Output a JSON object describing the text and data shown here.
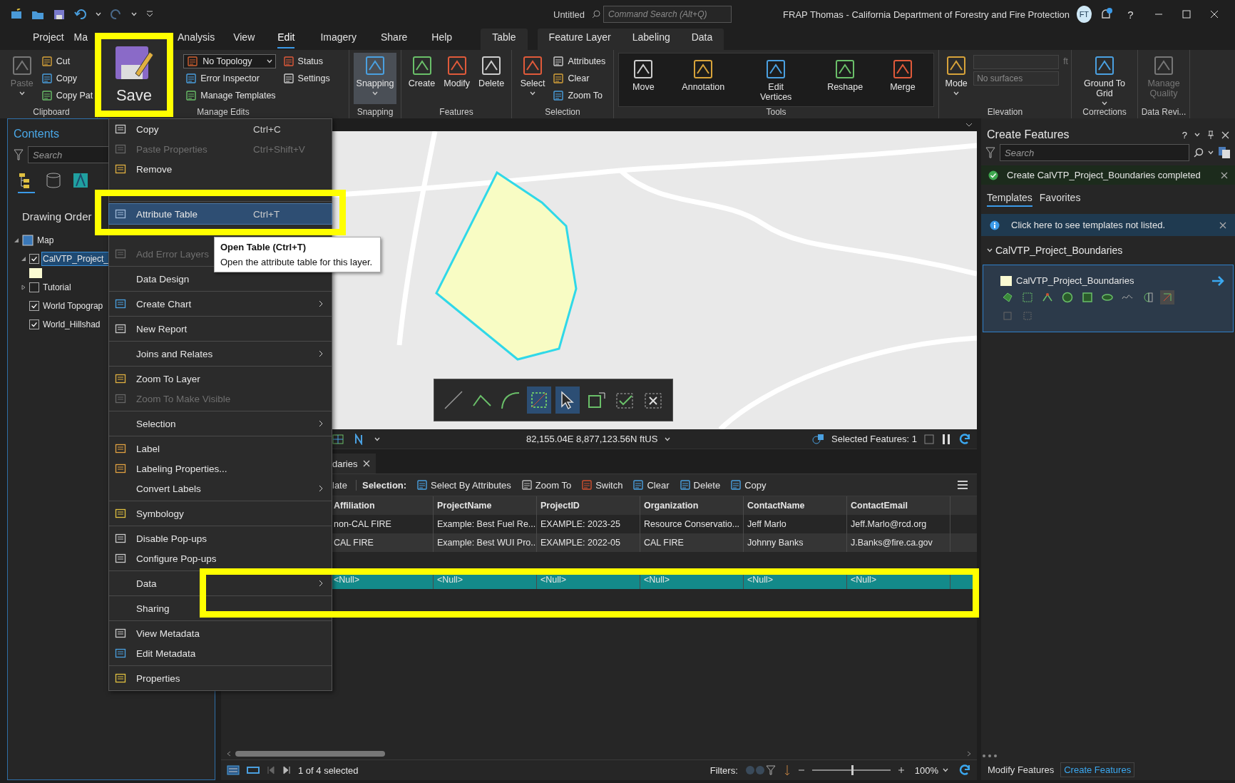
{
  "title_bar": {
    "document": "Untitled",
    "command_search": {
      "placeholder": "Command Search (Alt+Q)"
    },
    "title": "FRAP Thomas - California Department of Forestry and Fire Protection",
    "avatar": "FT",
    "help": "?"
  },
  "ribbon_tabs": [
    {
      "label": "Project",
      "selected": false
    },
    {
      "label": "Ma",
      "selected": false
    },
    {
      "label": "Analysis",
      "selected": false
    },
    {
      "label": "View",
      "selected": false
    },
    {
      "label": "Edit",
      "selected": true
    },
    {
      "label": "Imagery",
      "selected": false
    },
    {
      "label": "Share",
      "selected": false
    },
    {
      "label": "Help",
      "selected": false
    }
  ],
  "table_tabs": [
    {
      "label": "Table",
      "selected": false
    }
  ],
  "feature_layer_tabs": [
    {
      "label": "Feature Layer",
      "selected": false
    },
    {
      "label": "Labeling",
      "selected": false
    },
    {
      "label": "Data",
      "selected": false
    }
  ],
  "ribbon_groups": [
    {
      "label": "Clipboard",
      "kind": "plain",
      "buttons": [
        {
          "kind": "large",
          "label": "Paste",
          "disabled": true,
          "dropdown": true
        },
        {
          "kind": "small",
          "label": "Cut",
          "disabled": false
        },
        {
          "kind": "small",
          "label": "Copy",
          "disabled": false
        },
        {
          "kind": "small",
          "label": "Copy Pat",
          "disabled": false
        }
      ]
    },
    {
      "label": "Manage Edits",
      "kind": "plain",
      "buttons": [
        {
          "kind": "dropdown",
          "label": "No Topology",
          "disabled": false
        },
        {
          "kind": "small",
          "label": "Error Inspector",
          "disabled": false
        },
        {
          "kind": "small",
          "label": "Manage Templates",
          "disabled": false
        },
        {
          "kind": "small",
          "label": "Status",
          "disabled": false
        },
        {
          "kind": "small",
          "label": "Settings",
          "disabled": false
        }
      ]
    },
    {
      "label": "Snapping",
      "kind": "plain",
      "buttons": [
        {
          "kind": "large",
          "label": "Snapping",
          "disabled": false,
          "dropdown": true,
          "on": true
        }
      ]
    },
    {
      "label": "Features",
      "kind": "plain",
      "buttons": [
        {
          "kind": "large",
          "label": "Create",
          "disabled": false
        },
        {
          "kind": "large",
          "label": "Modify",
          "disabled": false
        },
        {
          "kind": "large",
          "label": "Delete",
          "disabled": false
        }
      ]
    },
    {
      "label": "Selection",
      "kind": "plain",
      "buttons": [
        {
          "kind": "large",
          "label": "Select",
          "disabled": false,
          "dropdown": true
        },
        {
          "kind": "small",
          "label": "Attributes",
          "disabled": false
        },
        {
          "kind": "small",
          "label": "Clear",
          "disabled": false
        },
        {
          "kind": "small",
          "label": "Zoom To",
          "disabled": false
        }
      ]
    },
    {
      "label": "Tools",
      "kind": "gallery",
      "buttons": [
        {
          "kind": "large",
          "label": "Move",
          "disabled": false
        },
        {
          "kind": "large",
          "label": "Annotation",
          "disabled": false
        },
        {
          "kind": "large",
          "label": "Edit Vertices",
          "disabled": false
        },
        {
          "kind": "large",
          "label": "Reshape",
          "disabled": false
        },
        {
          "kind": "large",
          "label": "Merge",
          "disabled": false
        }
      ]
    },
    {
      "label": "Elevation",
      "kind": "plain",
      "buttons": [
        {
          "kind": "large",
          "label": "Mode",
          "disabled": false,
          "dropdown": true
        },
        {
          "kind": "unit-field",
          "unit": "ft",
          "disabled": true
        },
        {
          "kind": "field",
          "placeholder": "No surfaces",
          "disabled": true
        }
      ]
    },
    {
      "label": "Corrections",
      "kind": "plain",
      "buttons": [
        {
          "kind": "large",
          "label": "Ground To Grid",
          "disabled": false,
          "dropdown": true
        }
      ]
    },
    {
      "label": "Data Revi...",
      "kind": "plain",
      "buttons": [
        {
          "kind": "large",
          "label": "Manage Quality",
          "disabled": true
        }
      ]
    }
  ],
  "save_callout": {
    "label": "Save"
  },
  "contents": {
    "title": "Contents",
    "search": {
      "placeholder": "Search"
    },
    "views": [
      {
        "selected": true
      },
      {
        "selected": false
      },
      {
        "selected": false
      }
    ],
    "heading": "Drawing Order",
    "tree": [
      {
        "label": "Map",
        "expanded": true,
        "children": [
          {
            "label": "CalVTP_Project_",
            "checked": true,
            "selected": true,
            "expanded": true
          },
          {
            "label": "Tutorial",
            "checked": false,
            "selected": false,
            "expanded": false
          },
          {
            "label": "World Topograp",
            "checked": true,
            "selected": false
          },
          {
            "label": "World_Hillshad",
            "checked": true,
            "selected": false
          }
        ]
      }
    ]
  },
  "context_menu": {
    "groups": [
      [
        {
          "kind": "item",
          "label": "Copy",
          "shortcut": "Ctrl+C",
          "disabled": false
        },
        {
          "kind": "item",
          "label": "Paste Properties",
          "shortcut": "Ctrl+Shift+V",
          "disabled": true
        },
        {
          "kind": "item",
          "label": "Remove",
          "disabled": false
        },
        {
          "kind": "covered"
        }
      ],
      [
        {
          "kind": "item",
          "label": "Attribute Table",
          "shortcut": "Ctrl+T",
          "disabled": false,
          "highlighted": true
        },
        {
          "kind": "covered"
        },
        {
          "kind": "item",
          "label": "Add Error Layers",
          "disabled": true
        }
      ],
      [
        {
          "kind": "item",
          "label": "Data Design",
          "disabled": false
        }
      ],
      [
        {
          "kind": "item",
          "label": "Create Chart",
          "disabled": false,
          "submenu": true
        }
      ],
      [
        {
          "kind": "item",
          "label": "New Report",
          "disabled": false
        }
      ],
      [
        {
          "kind": "item",
          "label": "Joins and Relates",
          "disabled": false,
          "submenu": true
        }
      ],
      [
        {
          "kind": "item",
          "label": "Zoom To Layer",
          "disabled": false
        },
        {
          "kind": "item",
          "label": "Zoom To Make Visible",
          "disabled": true
        }
      ],
      [
        {
          "kind": "item",
          "label": "Selection",
          "disabled": false,
          "submenu": true
        }
      ],
      [
        {
          "kind": "item",
          "label": "Label",
          "disabled": false
        },
        {
          "kind": "item",
          "label": "Labeling Properties...",
          "disabled": false
        },
        {
          "kind": "item",
          "label": "Convert Labels",
          "disabled": false,
          "submenu": true
        }
      ],
      [
        {
          "kind": "item",
          "label": "Symbology",
          "disabled": false
        }
      ],
      [
        {
          "kind": "item",
          "label": "Disable Pop-ups",
          "disabled": false
        },
        {
          "kind": "item",
          "label": "Configure Pop-ups",
          "disabled": false
        }
      ],
      [
        {
          "kind": "item",
          "label": "Data",
          "disabled": false,
          "submenu": true
        }
      ],
      [
        {
          "kind": "item",
          "label": "Sharing",
          "disabled": false
        }
      ],
      [
        {
          "kind": "item",
          "label": "View Metadata",
          "disabled": false
        },
        {
          "kind": "item",
          "label": "Edit Metadata",
          "disabled": false
        }
      ],
      [
        {
          "kind": "item",
          "label": "Properties",
          "disabled": false
        }
      ]
    ]
  },
  "tooltip": {
    "title": "Open Table (Ctrl+T)",
    "text": "Open the attribute table for this layer."
  },
  "edit_toolbar": {
    "tools": [
      {
        "selected": false
      },
      {
        "selected": false
      },
      {
        "selected": false
      },
      {
        "selected": true
      },
      {
        "selected": true
      },
      {
        "selected": false
      },
      {
        "selected": false
      },
      {
        "selected": false
      }
    ]
  },
  "map_status": {
    "coordinates": "82,155.04E 8,877,123.56N ftUS",
    "selected_features": "Selected Features: 1"
  },
  "table": {
    "tab": "daries",
    "toolbar": [
      {
        "kind": "text",
        "label": "late"
      },
      {
        "kind": "heading",
        "label": "Selection:"
      },
      {
        "kind": "button",
        "label": "Select By Attributes"
      },
      {
        "kind": "button",
        "label": "Zoom To"
      },
      {
        "kind": "button",
        "label": "Switch"
      },
      {
        "kind": "button",
        "label": "Clear"
      },
      {
        "kind": "button",
        "label": "Delete"
      },
      {
        "kind": "button",
        "label": "Copy"
      }
    ],
    "columns": [
      "Affiliation",
      "ProjectName",
      "ProjectID",
      "Organization",
      "ContactName",
      "ContactEmail"
    ],
    "rows": [
      {
        "selected": false,
        "cells": [
          "non-CAL FIRE",
          "Example: Best Fuel Re...",
          "EXAMPLE: 2023-25",
          "Resource Conservatio...",
          "Jeff Marlo",
          "Jeff.Marlo@rcd.org"
        ]
      },
      {
        "selected": false,
        "cells": [
          "CAL FIRE",
          "Example: Best WUI Pro...",
          "EXAMPLE: 2022-05",
          "CAL FIRE",
          "Johnny Banks",
          "J.Banks@fire.ca.gov"
        ]
      },
      {
        "selected": false,
        "cells": []
      },
      {
        "selected": true,
        "cells": [
          "<Null>",
          "<Null>",
          "<Null>",
          "<Null>",
          "<Null>",
          "<Null>"
        ]
      }
    ],
    "status": {
      "selection": "1 of 4 selected",
      "filters": "Filters:",
      "zoom": {
        "level": 0.5
      },
      "percent": "100%"
    }
  },
  "create_features": {
    "title": "Create Features",
    "help": "?",
    "search": {
      "placeholder": "Search"
    },
    "notification": "Create CalVTP_Project_Boundaries completed",
    "tabs": [
      {
        "label": "Templates",
        "selected": true
      },
      {
        "label": "Favorites",
        "selected": false
      }
    ],
    "info": "Click here to see templates not listed.",
    "group": "CalVTP_Project_Boundaries",
    "template": {
      "name": "CalVTP_Project_Boundaries",
      "selected": true,
      "tools": [
        {
          "selected": false
        },
        {
          "selected": false
        },
        {
          "selected": false
        },
        {
          "selected": false
        },
        {
          "selected": false
        },
        {
          "selected": false
        },
        {
          "selected": false
        },
        {
          "selected": false
        },
        {
          "selected": true
        },
        {
          "selected": false
        },
        {
          "selected": false
        }
      ]
    }
  },
  "pane_tabs": [
    {
      "label": "Modify Features",
      "selected": false
    },
    {
      "label": "Create Features",
      "selected": true
    }
  ]
}
